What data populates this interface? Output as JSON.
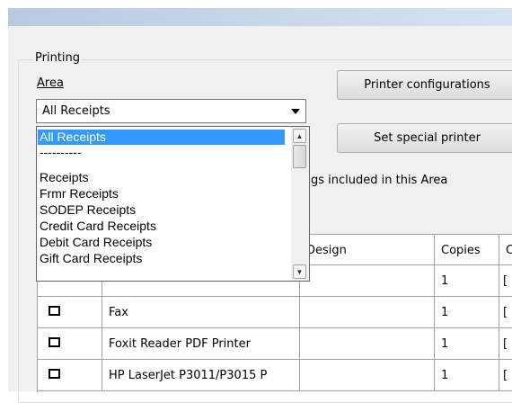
{
  "group": {
    "label": "Printing"
  },
  "area": {
    "label": "Area",
    "selected": "All Receipts",
    "options": [
      "All Receipts",
      "----------",
      "Receipts",
      "Frmr Receipts",
      "SODEP Receipts",
      "Credit Card Receipts",
      "Debit Card Receipts",
      "Gift Card Receipts"
    ]
  },
  "buttons": {
    "printer_config": "Printer configurations",
    "special_printer": "Set special printer"
  },
  "info_text": "gs included in this Area",
  "table": {
    "headers": {
      "design": "Design",
      "copies": "Copies",
      "next": "C"
    },
    "rows": [
      {
        "name": "",
        "design": "",
        "copies": "1",
        "next": "["
      },
      {
        "name": "Fax",
        "design": "",
        "copies": "1",
        "next": "["
      },
      {
        "name": "Foxit Reader PDF Printer",
        "design": "",
        "copies": "1",
        "next": "["
      },
      {
        "name": "HP LaserJet P3011/P3015 P",
        "design": "",
        "copies": "1",
        "next": "["
      }
    ]
  }
}
